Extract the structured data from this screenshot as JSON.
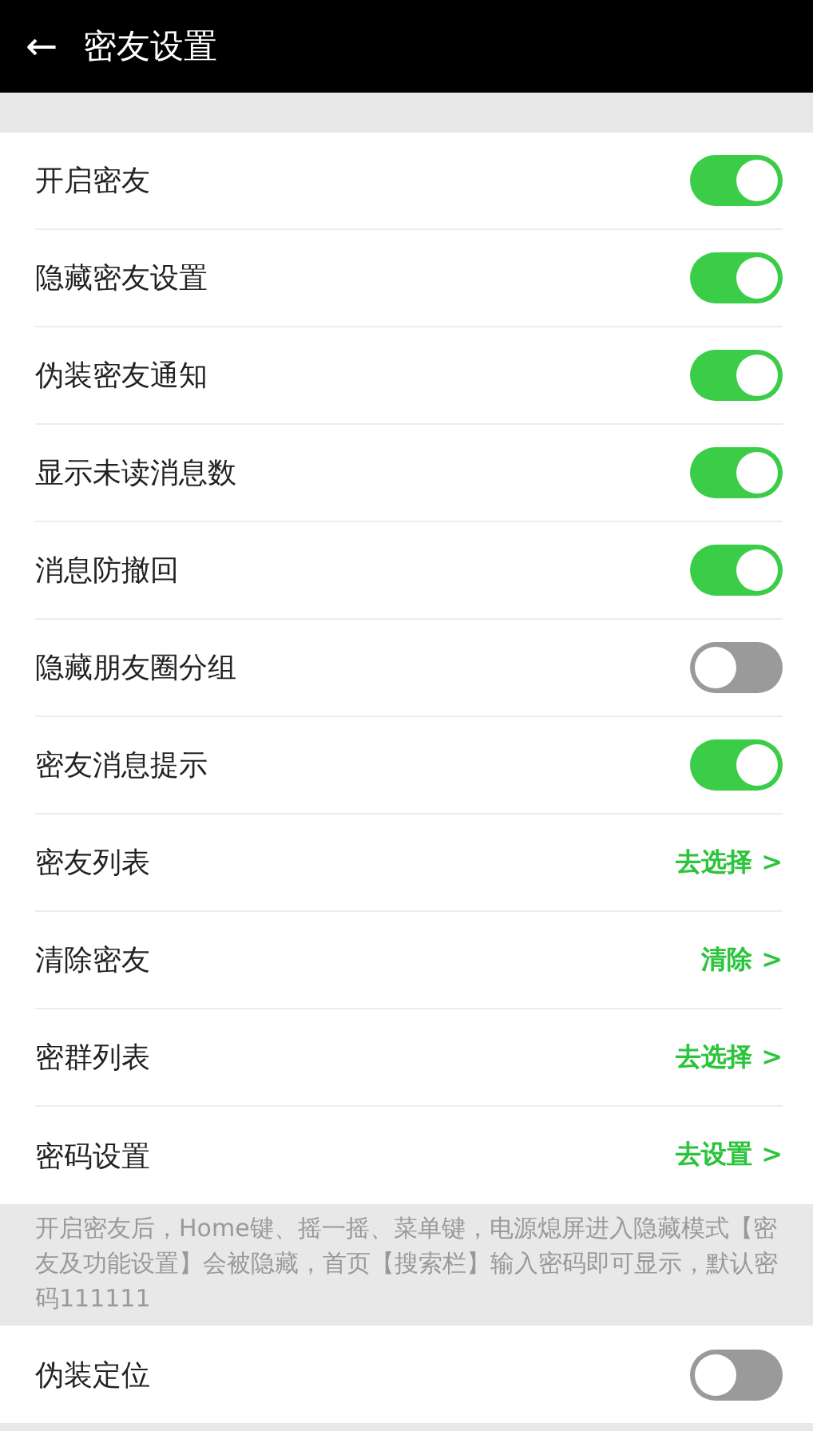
{
  "header": {
    "back": "←",
    "title": "密友设置"
  },
  "settings": [
    {
      "kind": "toggle",
      "label": "开启密友",
      "on": true
    },
    {
      "kind": "toggle",
      "label": "隐藏密友设置",
      "on": true
    },
    {
      "kind": "toggle",
      "label": "伪装密友通知",
      "on": true
    },
    {
      "kind": "toggle",
      "label": "显示未读消息数",
      "on": true
    },
    {
      "kind": "toggle",
      "label": "消息防撤回",
      "on": true
    },
    {
      "kind": "toggle",
      "label": "隐藏朋友圈分组",
      "on": false
    },
    {
      "kind": "toggle",
      "label": "密友消息提示",
      "on": true
    },
    {
      "kind": "link",
      "label": "密友列表",
      "action": "去选择 >"
    },
    {
      "kind": "link",
      "label": "清除密友",
      "action": "清除 >"
    },
    {
      "kind": "link",
      "label": "密群列表",
      "action": "去选择 >"
    },
    {
      "kind": "link",
      "label": "密码设置",
      "action": "去设置 >"
    }
  ],
  "note": "开启密友后，Home键、摇一摇、菜单键，电源熄屏进入隐藏模式【密友及功能设置】会被隐藏，首页【搜索栏】输入密码即可显示，默认密码111111",
  "extra_settings": [
    {
      "kind": "toggle",
      "label": "伪装定位",
      "on": false
    }
  ]
}
